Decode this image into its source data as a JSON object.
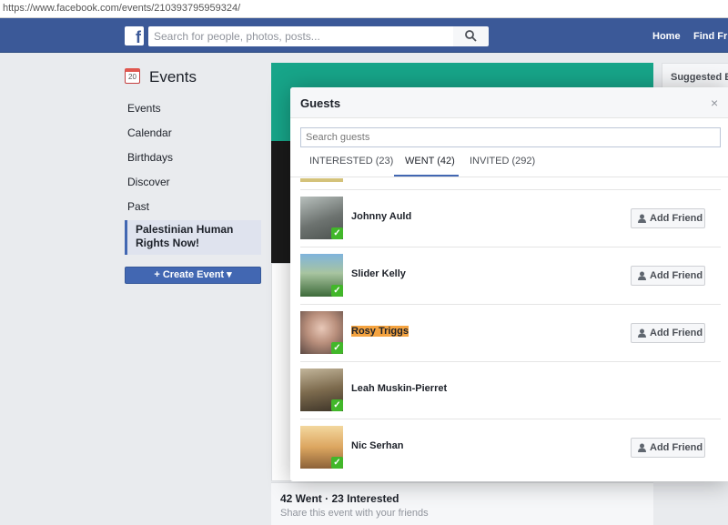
{
  "browser": {
    "url": "https://www.facebook.com/events/210393795959324/"
  },
  "header": {
    "logo": "f",
    "search_placeholder": "Search for people, photos, posts...",
    "nav_home": "Home",
    "nav_find_friends": "Find Frie"
  },
  "sidebar": {
    "title": "Events",
    "calendar_day": "20",
    "items": [
      "Events",
      "Calendar",
      "Birthdays",
      "Discover",
      "Past"
    ],
    "active_item": "Palestinian Human Rights Now!",
    "create_button": "+ Create Event ▾"
  },
  "event": {
    "summary": "42 Went · 23 Interested",
    "share_text": "Share this event with your friends",
    "suggested": "Suggested Ev"
  },
  "modal": {
    "title": "Guests",
    "close": "×",
    "search_placeholder": "Search guests",
    "tabs": [
      "INTERESTED (23)",
      "WENT (42)",
      "INVITED (292)"
    ],
    "active_tab": "WENT (42)",
    "add_friend_label": "Add Friend",
    "guests": [
      {
        "name": "Johnny Auld",
        "add_friend": true,
        "highlighted": false,
        "avatar_color": "#8a8f8a"
      },
      {
        "name": "Slider Kelly",
        "add_friend": true,
        "highlighted": false,
        "avatar_color": "#6fa8c8"
      },
      {
        "name": "Rosy Triggs",
        "add_friend": true,
        "highlighted": true,
        "avatar_color": "#c7a79a"
      },
      {
        "name": "Leah Muskin-Pierret",
        "add_friend": false,
        "highlighted": false,
        "avatar_color": "#8b7a5c"
      },
      {
        "name": "Nic Serhan",
        "add_friend": true,
        "highlighted": false,
        "avatar_color": "#d9a65a"
      }
    ]
  },
  "colors": {
    "fb_blue": "#3b5998",
    "accent": "#4267b2",
    "cover": "#17a589",
    "verified_green": "#42b72a",
    "highlight": "#f4a340"
  }
}
